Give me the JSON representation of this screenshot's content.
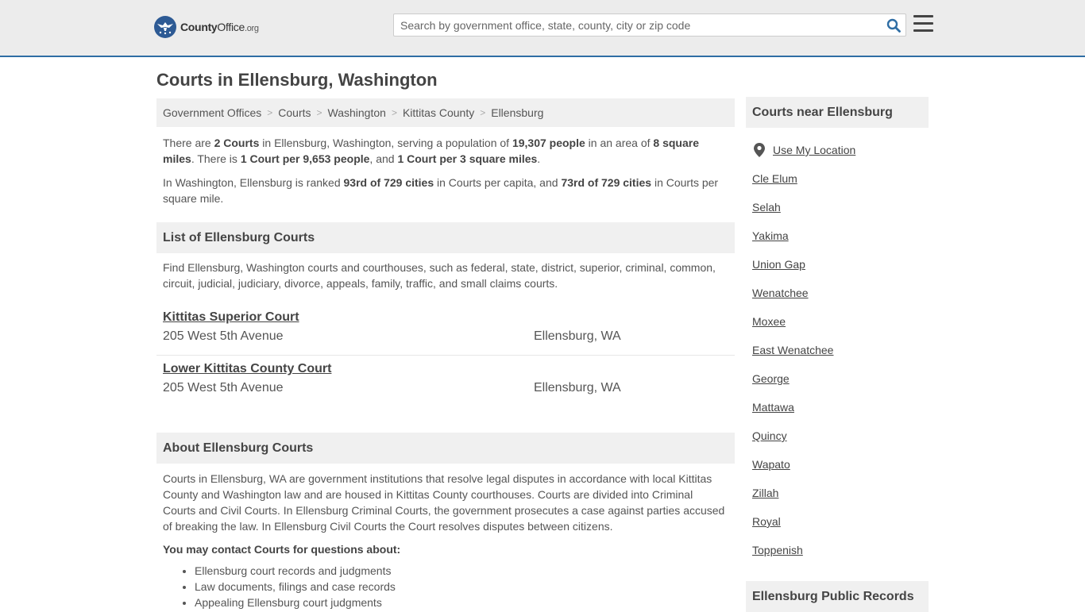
{
  "header": {
    "logo": {
      "name_bold": "County",
      "name_rest": "Office",
      "tld": ".org"
    },
    "search_placeholder": "Search by government office, state, county, city or zip code"
  },
  "page_title": "Courts in Ellensburg, Washington",
  "breadcrumb": [
    "Government Offices",
    "Courts",
    "Washington",
    "Kittitas County",
    "Ellensburg"
  ],
  "intro": {
    "p1": {
      "t1": "There are ",
      "b1": "2 Courts",
      "t2": " in Ellensburg, Washington, serving a population of ",
      "b2": "19,307 people",
      "t3": " in an area of ",
      "b3": "8 square miles",
      "t4": ". There is ",
      "b4": "1 Court per 9,653 people",
      "t5": ", and ",
      "b5": "1 Court per 3 square miles",
      "t6": "."
    },
    "p2": {
      "t1": "In Washington, Ellensburg is ranked ",
      "b1": "93rd of 729 cities",
      "t2": " in Courts per capita, and ",
      "b2": "73rd of 729 cities",
      "t3": " in Courts per square mile."
    }
  },
  "list_section": {
    "heading": "List of Ellensburg Courts",
    "description": "Find Ellensburg, Washington courts and courthouses, such as federal, state, district, superior, criminal, common, circuit, judicial, judiciary, divorce, appeals, family, traffic, and small claims courts.",
    "courts": [
      {
        "name": "Kittitas Superior Court",
        "address": "205 West 5th Avenue",
        "city": "Ellensburg, WA"
      },
      {
        "name": "Lower Kittitas County Court",
        "address": "205 West 5th Avenue",
        "city": "Ellensburg, WA"
      }
    ]
  },
  "about_section": {
    "heading": "About Ellensburg Courts",
    "body": "Courts in Ellensburg, WA are government institutions that resolve legal disputes in accordance with local Kittitas County and Washington law and are housed in Kittitas County courthouses. Courts are divided into Criminal Courts and Civil Courts. In Ellensburg Criminal Courts, the government prosecutes a case against parties accused of breaking the law. In Ellensburg Civil Courts the Court resolves disputes between citizens.",
    "contact_heading": "You may contact Courts for questions about:",
    "topics": [
      "Ellensburg court records and judgments",
      "Law documents, filings and case records",
      "Appealing Ellensburg court judgments"
    ]
  },
  "sidebar": {
    "heading": "Courts near Ellensburg",
    "use_location": "Use My Location",
    "cities": [
      "Cle Elum",
      "Selah",
      "Yakima",
      "Union Gap",
      "Wenatchee",
      "Moxee",
      "East Wenatchee",
      "George",
      "Mattawa",
      "Quincy",
      "Wapato",
      "Zillah",
      "Royal",
      "Toppenish"
    ],
    "records_heading": "Ellensburg Public Records"
  },
  "colors": {
    "header_bg": "#ececec",
    "header_border": "#2e6da4",
    "logo_blue": "#2d5a94",
    "search_icon": "#2e6da4",
    "panel_bg": "#f0f0f0"
  }
}
